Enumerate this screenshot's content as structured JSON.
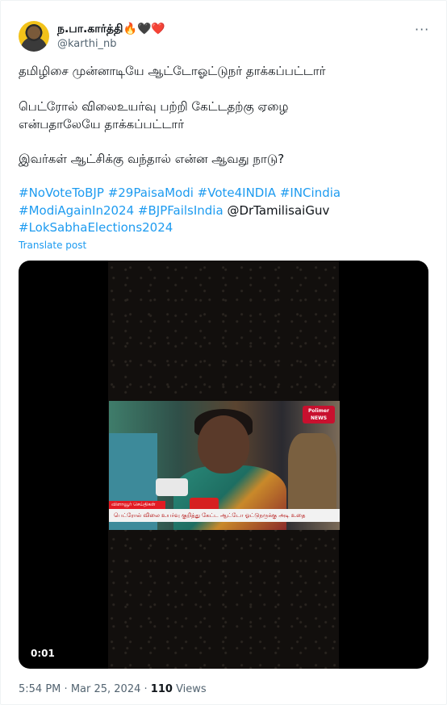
{
  "author": {
    "display_name": "ந.பா.கார்த்தி",
    "emoji": "🔥🖤❤️",
    "handle": "@karthi_nb"
  },
  "more_icon": "more-horizontal-icon",
  "post": {
    "line1": "தமிழிசை முன்னாடியே ஆட்டோஓட்டுநர் தாக்கப்பட்டார்",
    "line2a": "பெட்ரோல் விலைஉயர்வு பற்றி கேட்டதற்கு ஏழை",
    "line2b": "என்பதாலேயே தாக்கப்பட்டார்",
    "line3": "இவர்கள் ஆட்சிக்கு வந்தால் என்ன ஆவது நாடு?",
    "hashtags_row1": [
      "#NoVoteToBJP",
      "#29PaisaModi",
      "#Vote4INDIA",
      "#INCindia"
    ],
    "hashtags_row2": [
      "#ModiAgainIn2024",
      "#BJPFailsIndia"
    ],
    "mention": "@DrTamilisaiGuv",
    "hashtags_row3": [
      "#LokSabhaElections2024"
    ],
    "translate_label": "Translate post"
  },
  "video": {
    "timestamp": "0:01",
    "channel_logo_text": "Polimer NEWS",
    "lower_third_label": "விளாவூர் செய்திகள்",
    "lower_third_caption": "பெட்ரோல் விலை உயர்வு குறித்து கேட்ட ஆட்டோ ஓட்டுநருக்கு அடி உதை"
  },
  "meta": {
    "time": "5:54 PM",
    "separator": "·",
    "date": "Mar 25, 2024",
    "views_count": "110",
    "views_label": "Views"
  },
  "colors": {
    "link": "#1d9bf0",
    "text": "#0f1419",
    "secondary": "#536471"
  }
}
